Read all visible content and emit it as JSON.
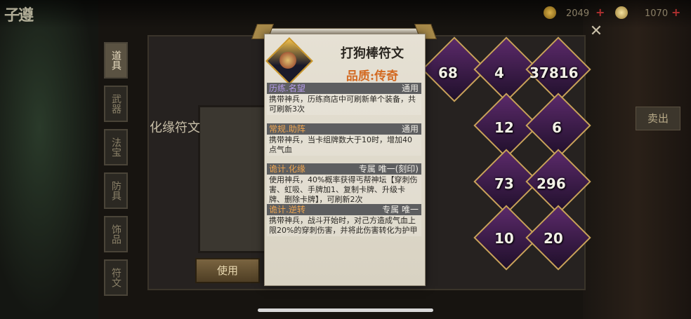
{
  "header": {
    "logo_text": "子遵",
    "currency1_value": "2049",
    "currency2_value": "1070"
  },
  "sidebar": {
    "tabs": [
      "道具",
      "武器",
      "法宝",
      "防具",
      "饰品",
      "符文"
    ]
  },
  "panel": {
    "title": "化缘符文",
    "use_button": "使用",
    "side_button": "卖出"
  },
  "grid": {
    "counts": [
      "68",
      "4",
      "37816",
      "12",
      "6",
      "73",
      "296",
      "10",
      "20"
    ]
  },
  "popup": {
    "title": "打狗棒符文",
    "quality": "品质:传奇",
    "entries": [
      {
        "name": "历练.名望",
        "tag": "通用",
        "desc": "携带神兵，历练商店中可刷新单个装备，共可刷新3次"
      },
      {
        "name": "常规.助阵",
        "tag": "通用",
        "desc": "携带神兵，当卡组牌数大于10时，增加40点气血"
      },
      {
        "name": "诡计.化缘",
        "tag": "专属 唯一(刻印)",
        "desc": "使用神兵，40%概率获得丐帮神坛【穿刺伤害、虹吸、手牌加1、复制卡牌、升级卡牌、删除卡牌】，可刷新2次"
      },
      {
        "name": "诡计.逆转",
        "tag": "专属 唯一",
        "desc": "携带神兵，战斗开始时，对己方造成气血上限20%的穿刺伤害，并将此伤害转化为护甲"
      }
    ]
  },
  "colors": {
    "quality": "#d36a22",
    "entry_name": "#f0a650",
    "entry_name_highlight": "#b59bea"
  }
}
